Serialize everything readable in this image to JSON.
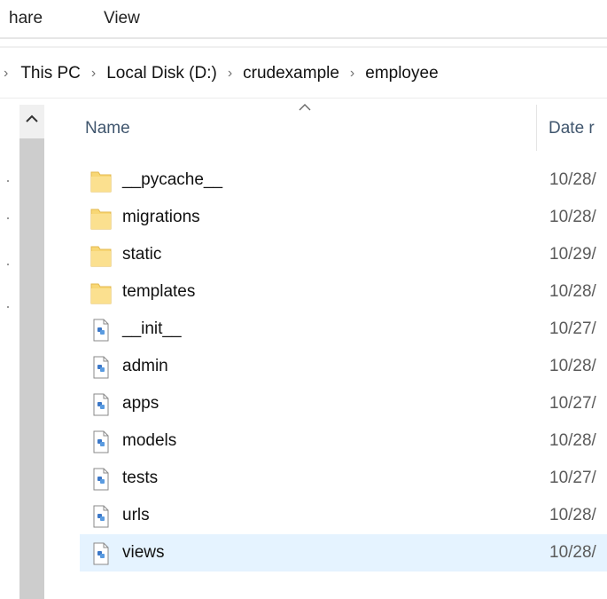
{
  "ribbon": {
    "tabs": [
      "hare",
      "View"
    ]
  },
  "breadcrumb": [
    "This PC",
    "Local Disk (D:)",
    "crudexample",
    "employee"
  ],
  "columns": {
    "name": "Name",
    "date": "Date r"
  },
  "files": [
    {
      "name": "__pycache__",
      "date": "10/28/",
      "type": "folder"
    },
    {
      "name": "migrations",
      "date": "10/28/",
      "type": "folder"
    },
    {
      "name": "static",
      "date": "10/29/",
      "type": "folder"
    },
    {
      "name": "templates",
      "date": "10/28/",
      "type": "folder"
    },
    {
      "name": "__init__",
      "date": "10/27/",
      "type": "python-file"
    },
    {
      "name": "admin",
      "date": "10/28/",
      "type": "python-file"
    },
    {
      "name": "apps",
      "date": "10/27/",
      "type": "python-file"
    },
    {
      "name": "models",
      "date": "10/28/",
      "type": "python-file"
    },
    {
      "name": "tests",
      "date": "10/27/",
      "type": "python-file"
    },
    {
      "name": "urls",
      "date": "10/28/",
      "type": "python-file"
    },
    {
      "name": "views",
      "date": "10/28/",
      "type": "python-file",
      "selected": true
    }
  ],
  "colors": {
    "selection": "#e5f3ff",
    "folder": "#f8d775",
    "header_text": "#40566e",
    "python_blue": "#3c78c8"
  }
}
